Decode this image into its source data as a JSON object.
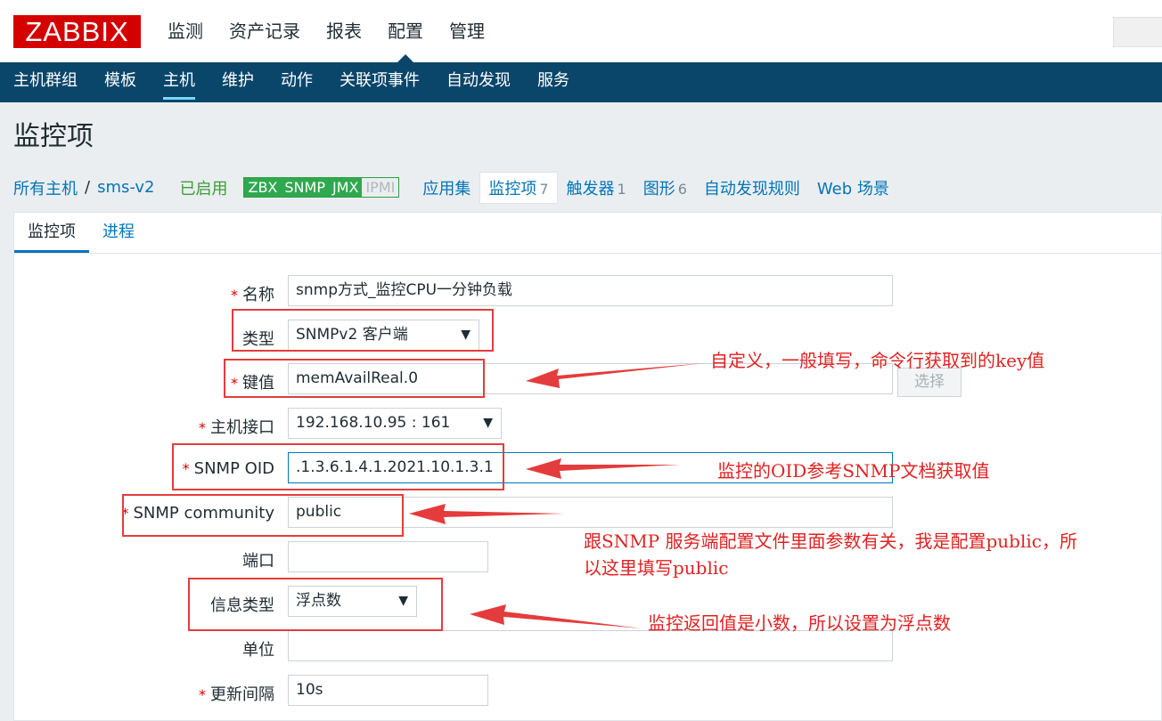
{
  "header": {
    "logo": "ZABBIX",
    "menu": [
      "监测",
      "资产记录",
      "报表",
      "配置",
      "管理"
    ],
    "active_menu": "配置"
  },
  "subnav": {
    "items": [
      "主机群组",
      "模板",
      "主机",
      "维护",
      "动作",
      "关联项事件",
      "自动发现",
      "服务"
    ],
    "active": "主机"
  },
  "page": {
    "title": "监控项"
  },
  "hostnav": {
    "all_hosts": "所有主机",
    "separator": "/",
    "host": "sms-v2",
    "status": "已启用",
    "availability": [
      "ZBX",
      "SNMP",
      "JMX",
      "IPMI"
    ],
    "tabs": [
      {
        "label": "应用集",
        "count": ""
      },
      {
        "label": "监控项",
        "count": "7"
      },
      {
        "label": "触发器",
        "count": "1"
      },
      {
        "label": "图形",
        "count": "6"
      },
      {
        "label": "自动发现规则",
        "count": ""
      },
      {
        "label": "Web 场景",
        "count": ""
      }
    ]
  },
  "form": {
    "tabs": [
      "监控项",
      "进程"
    ],
    "name": {
      "label": "名称",
      "value": "snmp方式_监控CPU一分钟负载"
    },
    "type": {
      "label": "类型",
      "value": "SNMPv2 客户端"
    },
    "key": {
      "label": "键值",
      "value": "memAvailReal.0",
      "button": "选择"
    },
    "interface": {
      "label": "主机接口",
      "value": "192.168.10.95 : 161"
    },
    "oid": {
      "label": "SNMP OID",
      "value": ".1.3.6.1.4.1.2021.10.1.3.1"
    },
    "community": {
      "label": "SNMP community",
      "value": "public"
    },
    "port": {
      "label": "端口",
      "value": ""
    },
    "info_type": {
      "label": "信息类型",
      "value": "浮点数"
    },
    "units": {
      "label": "单位",
      "value": ""
    },
    "interval": {
      "label": "更新间隔",
      "value": "10s"
    }
  },
  "annotations": {
    "key_note": "自定义，一般填写，命令行获取到的key值",
    "oid_note": "监控的OID参考SNMP文档获取值",
    "community_note_line1": "跟SNMP 服务端配置文件里面参数有关，我是配置public，所",
    "community_note_line2": "以这里填写public",
    "infotype_note": "监控返回值是小数，所以设置为浮点数",
    "color": "#e02222"
  }
}
